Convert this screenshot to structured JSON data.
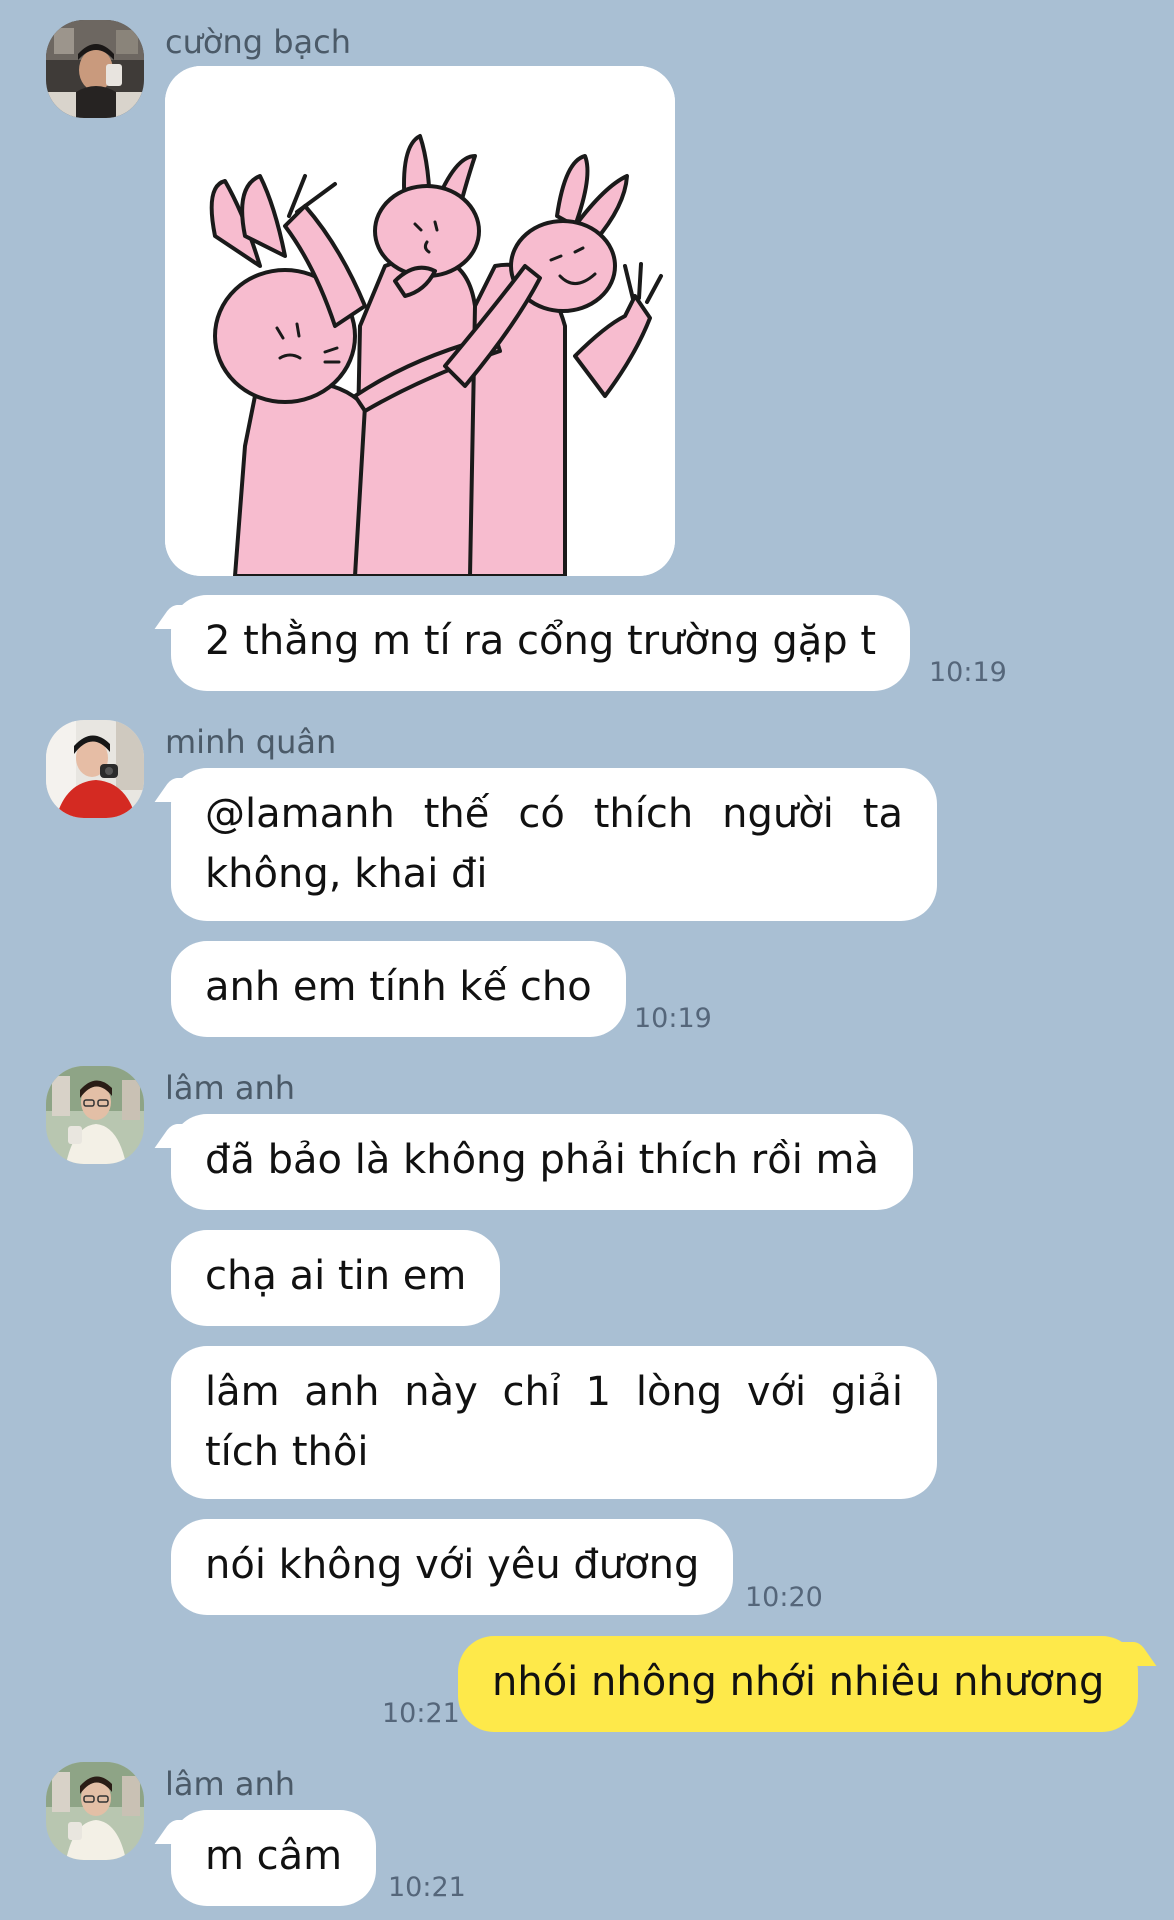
{
  "messages": [
    {
      "sender": "cường bạch",
      "avatar": "avatar-cuong-bach",
      "sticker": "three-pink-bunnies-sticker",
      "text": "2 thằng m tí ra cổng trường gặp t",
      "time": "10:19"
    },
    {
      "sender": "minh quân",
      "avatar": "avatar-minh-quan",
      "texts": [
        "@lamanh thế có thích người ta không, khai đi",
        "anh em tính kế cho"
      ],
      "time": "10:19"
    },
    {
      "sender": "lâm anh",
      "avatar": "avatar-lam-anh",
      "texts": [
        "đã bảo là không phải thích rồi mà",
        "chạ ai tin em",
        "lâm anh này chỉ 1 lòng với giải tích thôi",
        "nói không với yêu đương"
      ],
      "time": "10:20"
    },
    {
      "mine": true,
      "text": "nhói nhông nhới nhiêu nhương",
      "time": "10:21"
    },
    {
      "sender": "lâm anh",
      "avatar": "avatar-lam-anh",
      "text": "m câm",
      "time": "10:21"
    }
  ],
  "colors": {
    "background": "#a9bfd3",
    "incoming_bubble": "#ffffff",
    "outgoing_bubble": "#fee94a",
    "sticker_pink": "#f7bccf"
  }
}
